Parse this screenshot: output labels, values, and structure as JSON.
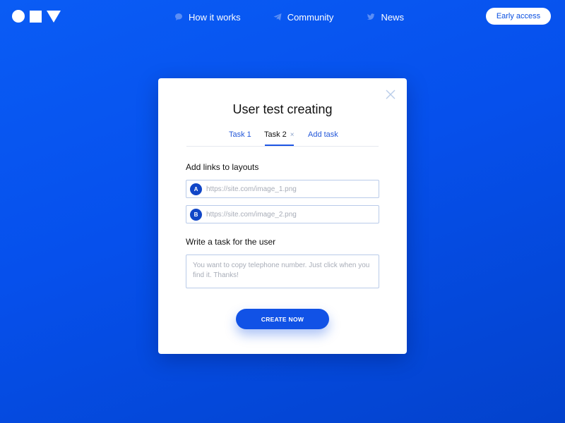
{
  "header": {
    "logo": {
      "shapes": [
        "circle",
        "square",
        "triangle"
      ]
    },
    "nav": [
      {
        "label": "How it works",
        "icon": "chat-bubble-icon"
      },
      {
        "label": "Community",
        "icon": "telegram-icon"
      },
      {
        "label": "News",
        "icon": "twitter-icon"
      }
    ],
    "early_access_label": "Early access"
  },
  "modal": {
    "title": "User test creating",
    "tabs": [
      {
        "label": "Task 1",
        "active": false
      },
      {
        "label": "Task 2",
        "active": true,
        "closable": true,
        "close_glyph": "×"
      },
      {
        "label": "Add task",
        "active": false
      }
    ],
    "links_label": "Add links to layouts",
    "links": [
      {
        "badge": "A",
        "value": "",
        "placeholder": "https://site.com/image_1.png"
      },
      {
        "badge": "B",
        "value": "",
        "placeholder": "https://site.com/image_2.png"
      }
    ],
    "task_label": "Write a task for the user",
    "task": {
      "value": "",
      "placeholder": "You want to copy telephone number. Just click when you find it. Thanks!"
    },
    "create_label": "CREATE NOW"
  },
  "colors": {
    "background": "#0650ec",
    "accent": "#1152e6",
    "badge": "#1146c7",
    "link_text": "#2458d9",
    "field_border": "#b9cbe9"
  }
}
